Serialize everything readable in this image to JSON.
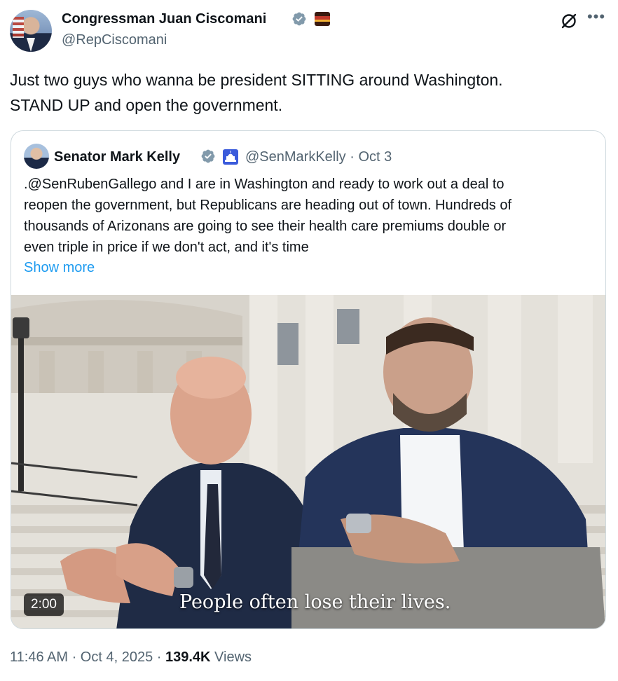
{
  "author": {
    "name": "Congressman Juan Ciscomani",
    "handle": "@RepCiscomani"
  },
  "tweet": {
    "text_line1": "Just two guys who wanna be president SITTING around Washington.",
    "text_line2": "STAND UP and open the government."
  },
  "quoted": {
    "name": "Senator Mark Kelly",
    "handle_date": "@SenMarkKelly · Oct 3",
    "text_lines": [
      ".@SenRubenGallego and I are in Washington and ready to work out a deal to",
      "reopen the government, but Republicans are heading out of town. Hundreds of",
      "thousands of Arizonans are going to see their health care premiums double or",
      "even triple in price if we don't act, and it's time"
    ],
    "show_more": "Show more",
    "video": {
      "duration": "2:00",
      "caption": "People often lose their lives."
    }
  },
  "meta": {
    "time_date": "11:46 AM · Oct 4, 2025 · ",
    "views_count": "139.4K",
    "views_label": " Views"
  },
  "colors": {
    "verified": "#829aab",
    "link": "#1d9bf0",
    "secondary_text": "#536471"
  },
  "icons": [
    "verified-badge-icon",
    "flag-badge-icon",
    "grok-icon",
    "more-icon",
    "capitol-icon"
  ]
}
